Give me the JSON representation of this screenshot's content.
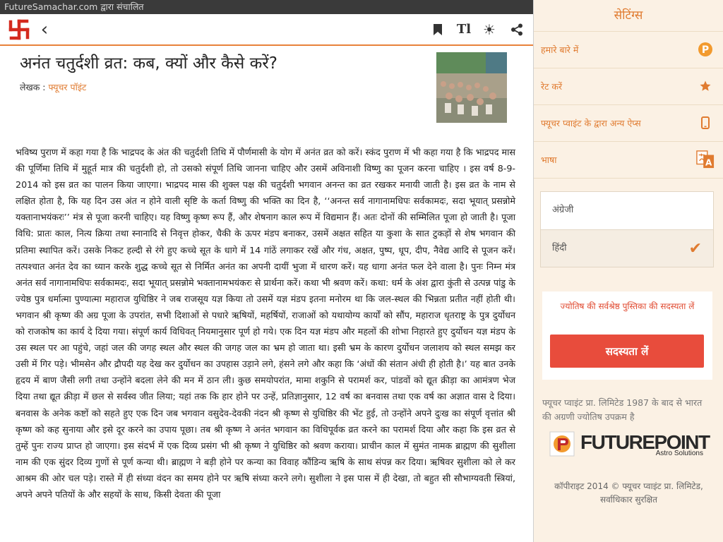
{
  "topbar": {
    "text": "FutureSamachar.com द्वारा संचालित"
  },
  "toolbar": {
    "logo_icon": "swastik-logo-icon",
    "back_glyph": "‹",
    "text_size_glyph": "Tl",
    "theme_glyph": "☀",
    "icons": [
      "bookmark-icon",
      "text-size-icon",
      "brightness-icon",
      "share-icon"
    ]
  },
  "article": {
    "title": "अनंत चतुर्दशी व्रत: कब, क्यों और कैसे करें?",
    "author_label": "लेखक :",
    "author_name": "फ्यूचर पॉइंट",
    "body": "भविष्य पुराण में कहा गया है कि भाद्रपद के अंत की चतुर्दशी तिथि में पौर्णमासी के योग में अनंत व्रत को करें। स्कंद पुराण में भी कहा गया है कि भाद्रपद मास की पूर्णिमा तिथि में मुहूर्त मात्र की चतुर्दशी हो, तो उसको संपूर्ण तिथि जानना चाहिए और उसमें अविनाशी विष्णु का पूजन करना चाहिए । इस वर्ष 8-9-2014 को इस व्रत का पालन किया जाएगा। भाद्रपद मास की शुक्ल पक्ष की चतुर्दशी भगवान अनन्त का व्रत रखकर मनायी जाती है। इस व्रत के नाम से लक्षित होता है, कि यह दिन उस अंत न होने वाली सृष्टि के कर्ता विष्णु की भक्ति का दिन है, ‘‘अनन्त सर्व नागानामधिपः सर्वकामदः, सदा भूयात् प्रसन्नोमे यक्ताना​भयंकरः’’ मंत्र से पूजा करनी चाहिए। यह विष्णु कृष्ण रूप हैं, और शेषनाग काल रूप में विद्यमान हैं। अतः दोनों की सम्मिलित पूजा हो जाती है। पूजा विधि: प्रातः काल, नित्य क्रिया तथा स्नानादि से निवृत्त होकर, चैकी के ऊपर मंडप बनाकर, उसमें अक्षत सहित या कुशा के सात टुकड़ों से शेष भगवान की प्रतिमा स्थापित करें। उसके निकट हल्दी से रंगे हुए कच्चे सूत के धागे में 14 गांठें लगाकर रखें और गंध, अक्षत, पुष्प, धूप, दीप, नैवेद्य आदि से पूजन करें। तत्पश्चात अनंत देव का ध्यान करके शुद्ध कच्चे सूत से निर्मित अनंत का अपनी दायीं भुजा में धारण करें। यह धागा अनंत फल देने वाला है। पुनः निम्न मंत्र अनंत सर्व नागानामधिपः सर्वकामदः, सदा भूयात् प्रसन्नोमे भक्तानामभयंकरः से प्रार्थना करें। कथा भी श्रवण करें। कथा: धर्म के अंश द्वारा कुंती से उत्पन्न पांडु के ज्येष्ठ पुत्र धर्मात्मा पुण्यात्मा महाराज युधिष्ठिर ने जब राजसूय यज्ञ किया तो उसमें यज्ञ मंडप इतना मनोरम था कि जल-स्थल की भिन्नता प्रतीत नहीं होती थी। भगवान श्री कृष्ण की अग्र पूजा के उपरांत, सभी दिशाओं से पधारे ऋषियों, महर्षियों, राजाओं को यथायोग्य कार्यों को सौंप, महाराज धृतराष्ट्र के पुत्र दुर्योधन को राजकोष का कार्य दे दिया गया। संपूर्ण कार्य विधिवत् नियमानुसार पूर्ण हो गये। एक दिन यज्ञ मंडप और महलों की शोभा निहारते हुए दुर्योधन यज्ञ मंडप के उस स्थल पर आ पहुंचे, जहां जल की जगह स्थल और स्थल की जगह जल का भ्रम हो जाता था। इसी भ्रम के कारण दुर्योधन जलाशय को स्थल समझ कर उसी में गिर पड़े। भीमसेन और द्रौपदी यह देख कर दुर्योधन का उपहास उड़ाने लगे, हंसने लगे और कहा कि ‘अंधों की संतान अंधी ही होती है।’ यह बात उनके हृदय में बाण जैसी लगी तथा उन्होंने बदला लेने की मन में ठान ली। कुछ समयोपरांत, मामा शकुनि से परामर्श कर, पांडवों को द्यूत क्रीड़ा का आमंत्रण भेज दिया तथा द्यूत क्रीड़ा में छल से सर्वस्व जीत लिया; यहां तक कि हार होने पर उन्हें, प्रतिज्ञानुसार, 12 वर्ष का बनवास तथा एक वर्ष का अज्ञात वास दे दिया। बनवास के अनेक कष्टों को सहते हुए एक दिन जब भगवान वसुदेव-देवकी नंदन श्री कृष्ण से युधिष्ठिर की भेंट हुई, तो उन्होंने अपने दुःख का संपूर्ण वृत्तांत श्री कृष्ण को कह सुनाया और इसे दूर करने का उपाय पूछा। तब श्री कृष्ण ने अनंत भगवान का विधिपूर्वक व्रत करने का परामर्श दिया और कहा कि इस व्रत से तुम्हें पुनः राज्य प्राप्त हो जाएगा। इस संदर्भ में एक दिव्य प्रसंग भी श्री कृष्ण ने युधिष्ठिर को श्रवण कराया। प्राचीन काल में सुमंत नामक ब्राह्मण की सुशीला नाम की एक सुंदर दिव्य गुणों से पूर्ण कन्या थी। ब्राह्मण ने बड़ी होने पर कन्या का विवाह कौंडिन्य ऋषि के साथ संपन्न कर दिया। ऋषिवर सुशीला को ले कर आश्रम की ओर चल पड़े। रास्ते में ही संध्या वंदन का समय होने पर ऋषि संध्या करने लगे। सुशीला ने इस पास में ही देखा, तो बहुत सी सौभाग्यवती स्त्रियां, अपने अपने पतियों के और सहयों के साथ, किसी देवता की पूजा"
  },
  "settings": {
    "title": "सेटिंग्स",
    "rows": [
      {
        "label": "हमारे बारे में",
        "icon": "futurepoint-p-icon"
      },
      {
        "label": "रेट करें",
        "icon": "star-icon"
      },
      {
        "label": "फ्यूचर प्वाइंट के द्वारा अन्य ऐप्स",
        "icon": "mobile-phone-icon"
      },
      {
        "label": "भाषा",
        "icon": "translate-icon"
      }
    ],
    "languages": [
      {
        "label": "अंग्रेजी",
        "selected": false
      },
      {
        "label": "हिंदी",
        "selected": true
      }
    ],
    "check_glyph": "✔",
    "subscription_text": "ज्योतिष की सर्वश्रेष्ठ पुस्तिका की सदस्यता लें",
    "subscribe_button": "सदस्यता लें",
    "about_text": "फ्यूचर प्वाइंट प्रा. लिमिटेड 1987 के बाद से भारत की अग्रणी ज्योतिष उपक्रम है",
    "brand_name": "FUTUREPOINT",
    "brand_tagline": "Astro Solutions",
    "copyright": "कॉपीराइट 2014 © फ्यूचर प्वाइंट प्रा. लिमिटेड, सर्वाधिकार सुरक्षित"
  },
  "colors": {
    "accent": "#e07b30",
    "button": "#e84c3c",
    "panel_bg": "#fbf1e4",
    "topbar_bg": "#3a3a3a"
  }
}
